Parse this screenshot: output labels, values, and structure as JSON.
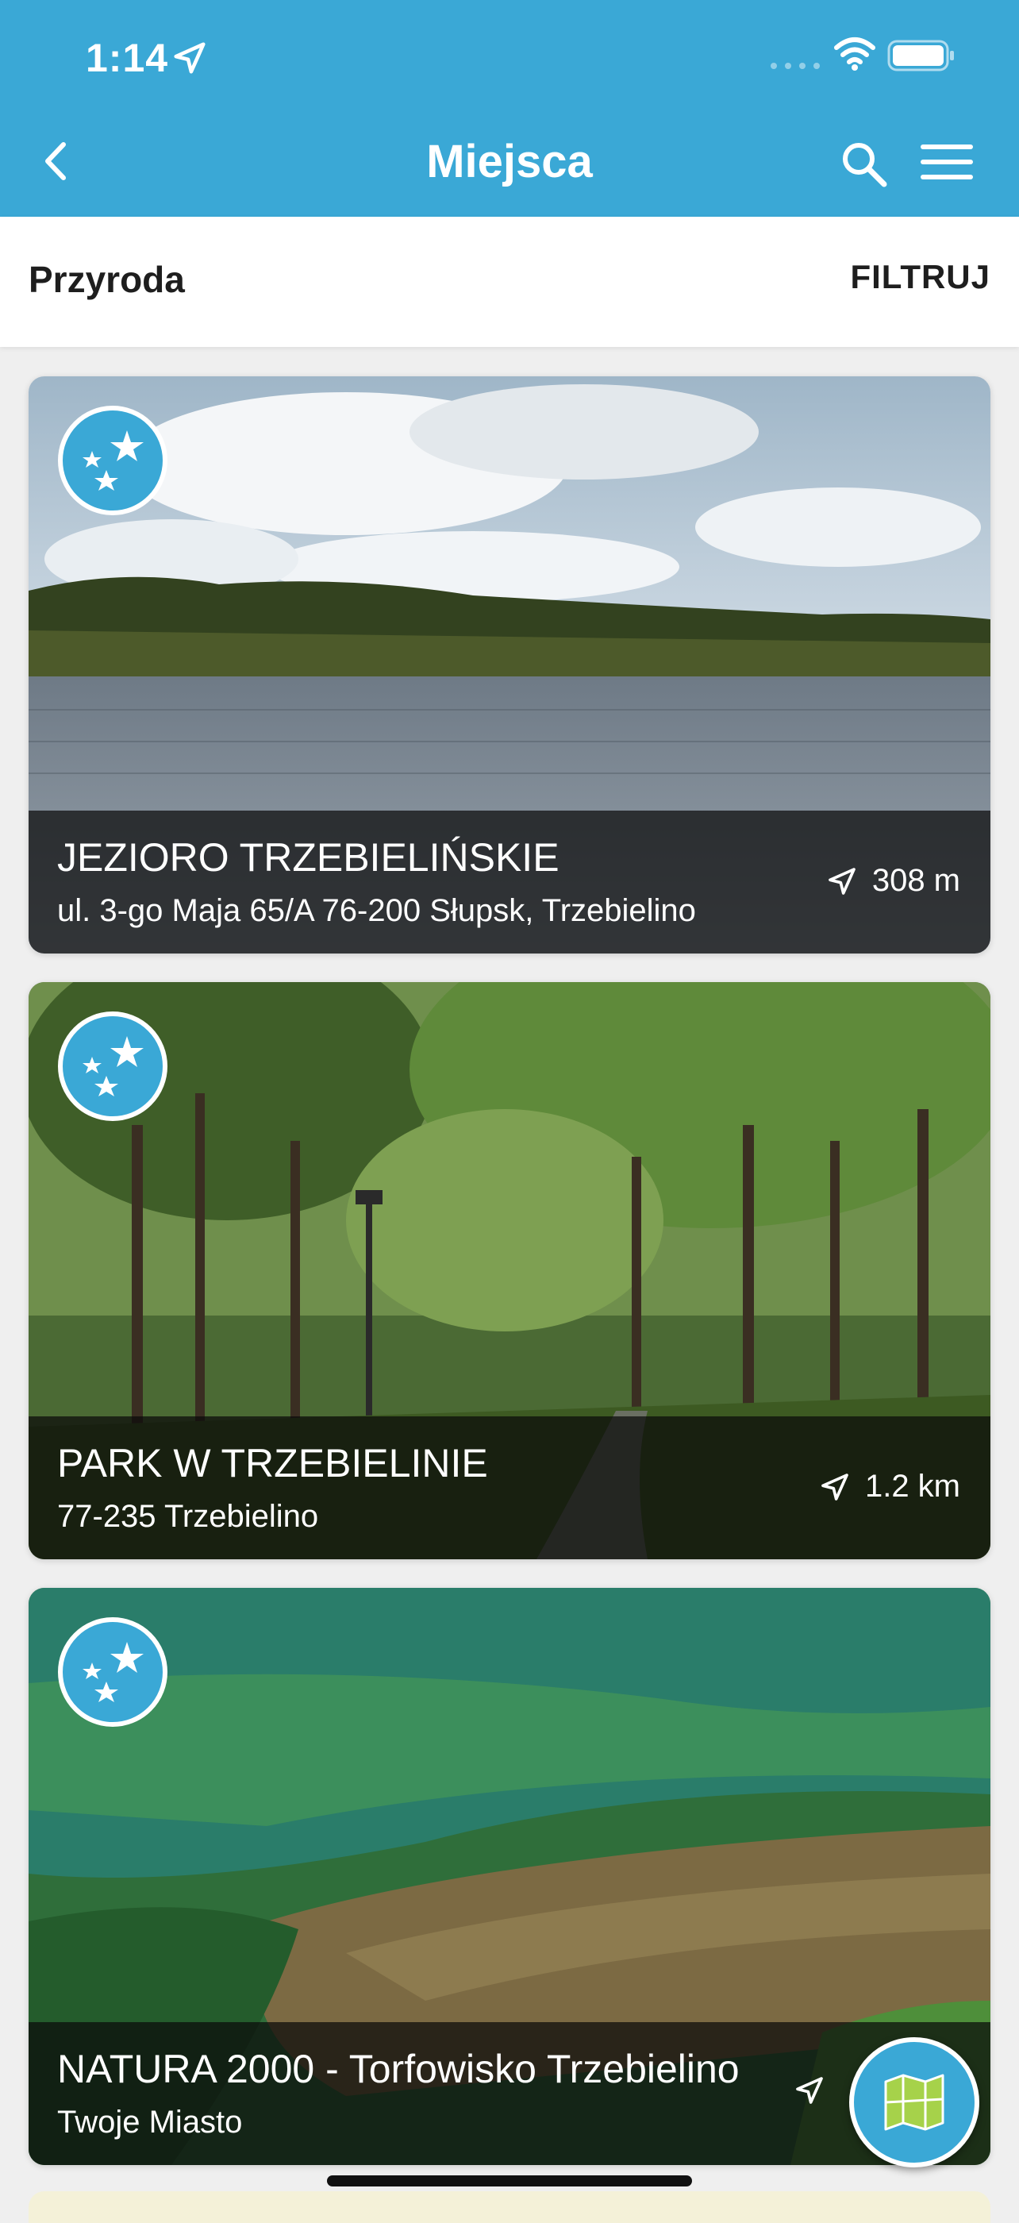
{
  "status_bar": {
    "time": "1:14"
  },
  "nav": {
    "title": "Miejsca"
  },
  "subbar": {
    "category": "Przyroda",
    "filter_label": "FILTRUJ"
  },
  "places": [
    {
      "title": "JEZIORO TRZEBIELIŃSKIE",
      "address": "ul. 3-go Maja 65/A 76-200 Słupsk,  Trzebielino",
      "distance": "308 m",
      "category_icon": "stars-icon"
    },
    {
      "title": "PARK W TRZEBIELINIE",
      "address": "77-235 Trzebielino",
      "distance": "1.2 km",
      "category_icon": "stars-icon"
    },
    {
      "title": "NATURA 2000 - Torfowisko Trzebielino",
      "address": "Twoje Miasto",
      "distance": "",
      "category_icon": "stars-icon"
    }
  ],
  "colors": {
    "primary": "#3aa8d6",
    "caption_bg": "#0a0a0a",
    "map_icon": "#a6d24a"
  }
}
